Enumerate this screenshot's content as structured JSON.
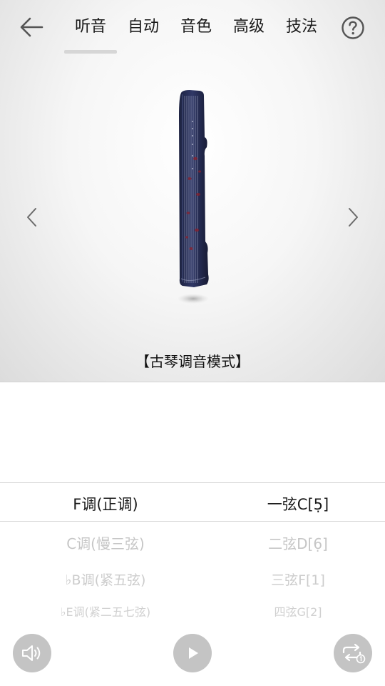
{
  "header": {
    "tabs": [
      {
        "label": "听音",
        "active": true
      },
      {
        "label": "自动",
        "active": false
      },
      {
        "label": "音色",
        "active": false
      },
      {
        "label": "高级",
        "active": false
      },
      {
        "label": "技法",
        "active": false
      }
    ],
    "icons": {
      "back": "arrow-left-icon",
      "help": "question-circle-icon"
    }
  },
  "viewer": {
    "mode_label": "【古琴调音模式】",
    "icons": {
      "prev": "chevron-left-icon",
      "next": "chevron-right-icon",
      "instrument": "guqin-image"
    }
  },
  "picker": {
    "tunings": [
      "F调(正调)",
      "C调(慢三弦)",
      "♭B调(紧五弦)",
      "♭E调(紧二五七弦)"
    ],
    "strings": [
      "一弦C[5̣]",
      "二弦D[6̣]",
      "三弦F[1]",
      "四弦G[2]"
    ],
    "selected_index": 0
  },
  "controls": {
    "icons": {
      "sound": "speaker-icon",
      "play": "play-icon",
      "loop": "repeat-one-icon"
    }
  },
  "colors": {
    "accent_inactive": "#c4c4c4",
    "text": "#1a1a1a",
    "faded_text": "#c6c6c6"
  }
}
